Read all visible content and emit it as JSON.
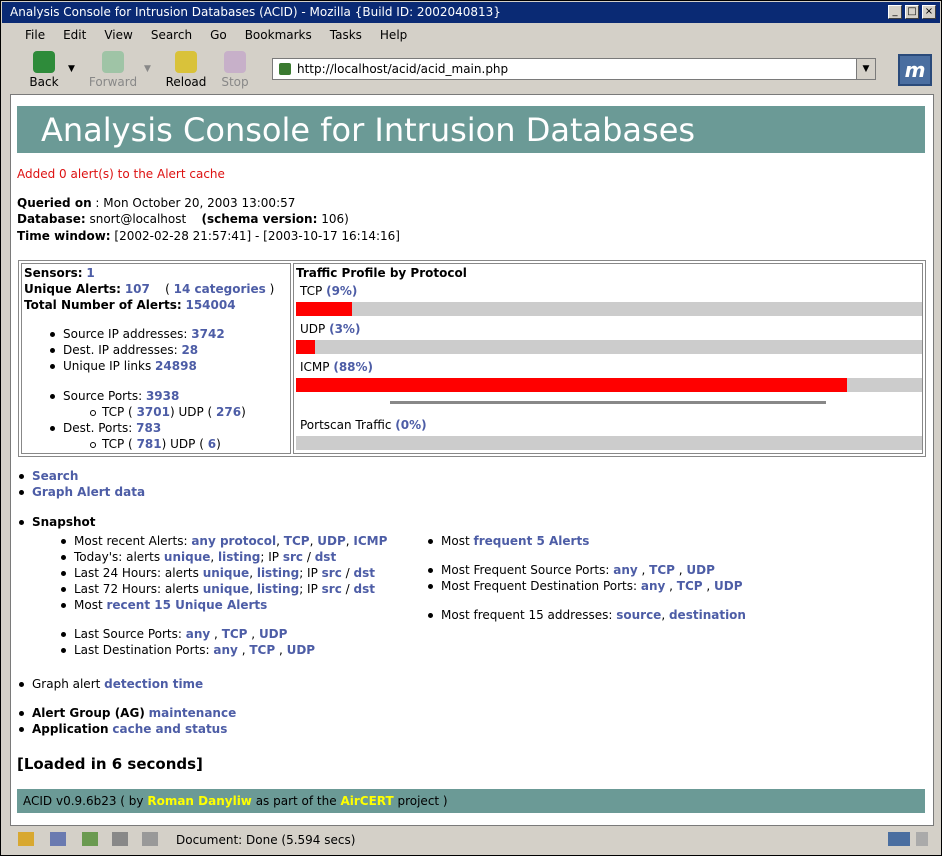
{
  "window": {
    "title": "Analysis Console for Intrusion Databases (ACID) - Mozilla {Build ID: 2002040813}"
  },
  "menu": [
    "File",
    "Edit",
    "View",
    "Search",
    "Go",
    "Bookmarks",
    "Tasks",
    "Help"
  ],
  "nav": {
    "back": "Back",
    "forward": "Forward",
    "reload": "Reload",
    "stop": "Stop",
    "url": "http://localhost/acid/acid_main.php"
  },
  "page": {
    "banner": "Analysis Console for Intrusion Databases",
    "cache_msg": "Added 0 alert(s) to the Alert cache",
    "queried_label": "Queried on",
    "queried_value": " : Mon October 20, 2003 13:00:57",
    "db_label": "Database:",
    "db_value": " snort@localhost ",
    "schema_label": "(schema version:",
    "schema_value": " 106)",
    "tw_label": "Time window:",
    "tw_value": " [2002-02-28 21:57:41] - [2003-10-17 16:14:16]"
  },
  "stats": {
    "sensors_label": "Sensors:",
    "sensors": "1",
    "unique_label": "Unique Alerts:",
    "unique": "107",
    "cat_pre": "( ",
    "categories": "14 categories",
    "cat_post": " )",
    "total_label": "Total Number of Alerts:",
    "total": "154004",
    "src_ip_label": "Source IP addresses:",
    "src_ip": "3742",
    "dst_ip_label": "Dest. IP addresses:",
    "dst_ip": "28",
    "links_label": "Unique IP links",
    "links": "24898",
    "src_ports_label": "Source Ports:",
    "src_ports": "3938",
    "src_tcp_pre": "TCP ( ",
    "src_tcp": "3701",
    "src_udp_pre": ")  UDP ( ",
    "src_udp": "276",
    "close": ")",
    "dst_ports_label": "Dest. Ports:",
    "dst_ports": "783",
    "dst_tcp_pre": "TCP ( ",
    "dst_tcp": "781",
    "dst_udp_pre": ")  UDP ( ",
    "dst_udp": "6"
  },
  "profile": {
    "title": "Traffic Profile by Protocol",
    "tcp_label": "TCP",
    "tcp_pct": "(9%)",
    "tcp_value": 0.09,
    "udp_label": "UDP",
    "udp_pct": "(3%)",
    "udp_value": 0.03,
    "icmp_label": "ICMP",
    "icmp_pct": "(88%)",
    "icmp_value": 0.88,
    "portscan_label": "Portscan Traffic",
    "portscan_pct": "(0%)",
    "portscan_value": 0.0
  },
  "links": {
    "search": "Search",
    "graph": "Graph Alert data",
    "snapshot": "Snapshot",
    "recent_label": "Most recent Alerts:",
    "any_protocol": "any protocol",
    "tcp": "TCP",
    "udp": "UDP",
    "icmp": "ICMP",
    "today_label": "Today's: alerts",
    "unique": "unique",
    "listing": "listing",
    "ip_label": "; IP",
    "src": "src",
    "slash": " / ",
    "dst": "dst",
    "last24_label": "Last 24 Hours:  alerts",
    "last72_label": "Last 72 Hours:  alerts",
    "most_label": "Most",
    "recent15": "recent 15 Unique Alerts",
    "last_src_label": "Last Source Ports:",
    "last_dst_label": "Last Destination Ports:",
    "any": "any",
    "freq5_pre": "Most",
    "freq5": "frequent 5 Alerts",
    "freq_src_label": "Most Frequent Source Ports:",
    "freq_dst_label": "Most Frequent Destination Ports:",
    "freq15_label": "Most frequent 15 addresses:",
    "source": "source",
    "destination": "destination",
    "graph_time_label": "Graph alert",
    "detection_time": "detection time",
    "ag_label": "Alert Group (AG)",
    "maintenance": "maintenance",
    "app_label": "Application",
    "cache_status": "cache and status",
    "loaded": "[Loaded in 6 seconds]"
  },
  "footer": {
    "pre": "ACID v0.9.6b23 ( by ",
    "author": "Roman Danyliw",
    "mid": " as part of the ",
    "project": "AirCERT",
    "post": " project )"
  },
  "status": {
    "text": "Document: Done (5.594 secs)"
  },
  "colors": {
    "banner": "#6b9a96",
    "link": "#4d5da6",
    "bar": "#ff0000",
    "title_bar": "#0a2a74"
  }
}
